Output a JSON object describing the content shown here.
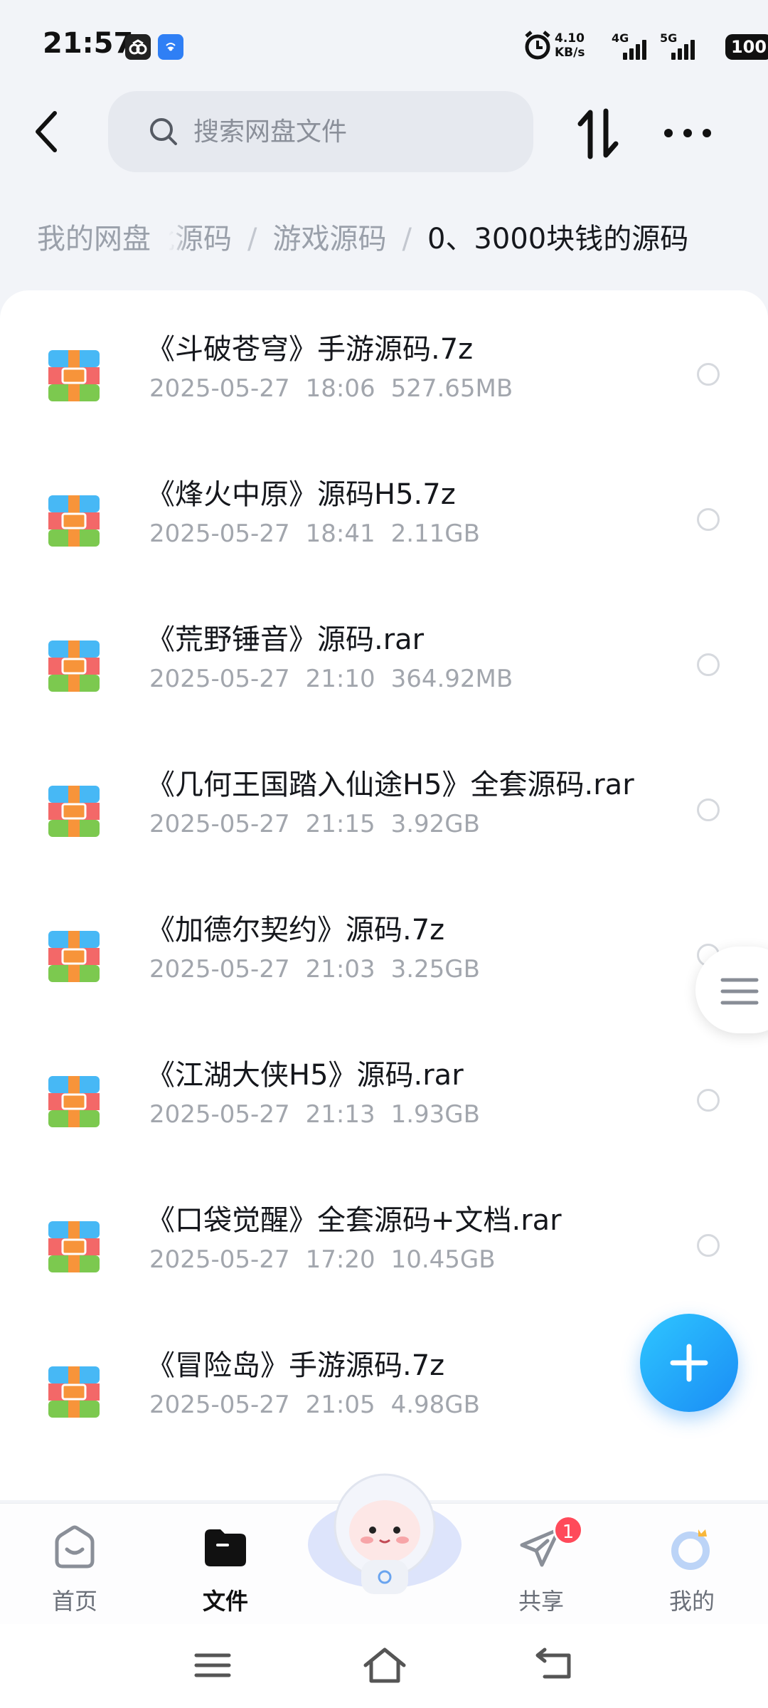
{
  "status_bar": {
    "time": "21:57",
    "speed_value": "4.10",
    "speed_unit": "KB/s",
    "network_1": "4G",
    "network_2": "5G",
    "battery": "100"
  },
  "header": {
    "search_placeholder": "搜索网盘文件"
  },
  "breadcrumb": {
    "home": "我的网盘",
    "items": [
      "批源码",
      "游戏源码",
      "0、3000块钱的源码"
    ]
  },
  "files": [
    {
      "name": "《斗破苍穹》手游源码.7z",
      "date": "2025-05-27",
      "time": "18:06",
      "size": "527.65MB"
    },
    {
      "name": "《烽火中原》源码H5.7z",
      "date": "2025-05-27",
      "time": "18:41",
      "size": "2.11GB"
    },
    {
      "name": "《荒野锤音》源码.rar",
      "date": "2025-05-27",
      "time": "21:10",
      "size": "364.92MB"
    },
    {
      "name": "《几何王国踏入仙途H5》全套源码.rar",
      "date": "2025-05-27",
      "time": "21:15",
      "size": "3.92GB"
    },
    {
      "name": "《加德尔契约》源码.7z",
      "date": "2025-05-27",
      "time": "21:03",
      "size": "3.25GB"
    },
    {
      "name": "《江湖大侠H5》源码.rar",
      "date": "2025-05-27",
      "time": "21:13",
      "size": "1.93GB"
    },
    {
      "name": "《口袋觉醒》全套源码+文档.rar",
      "date": "2025-05-27",
      "time": "17:20",
      "size": "10.45GB"
    },
    {
      "name": "《冒险岛》手游源码.7z",
      "date": "2025-05-27",
      "time": "21:05",
      "size": "4.98GB"
    }
  ],
  "bottom_nav": {
    "home": "首页",
    "files": "文件",
    "share": "共享",
    "share_badge": "1",
    "mine": "我的"
  },
  "icons": {
    "back": "chevron-left-icon",
    "search": "search-icon",
    "sort": "sort-arrows-icon",
    "more": "more-dots-icon",
    "file": "archive-file-icon",
    "fab": "plus-icon"
  },
  "colors": {
    "accent": "#1a8cf5",
    "badge": "#ff4a5a",
    "background": "#f2f4f8"
  }
}
